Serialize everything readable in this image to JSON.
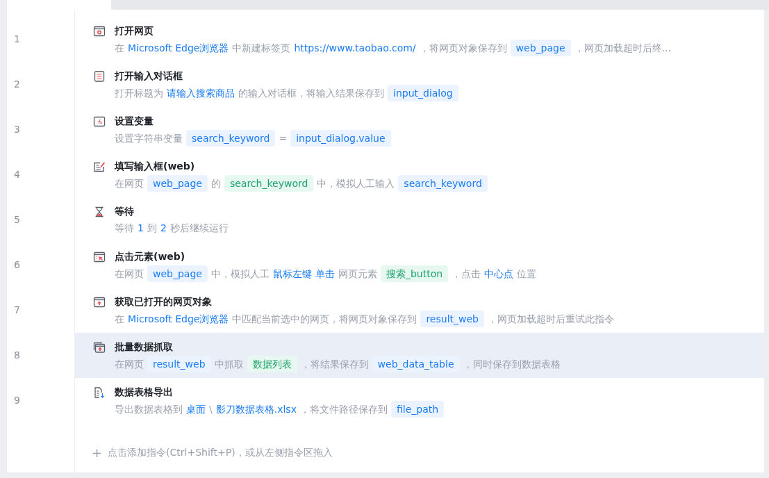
{
  "steps": [
    {
      "number": "1",
      "kind": "browser",
      "title": "打开网页",
      "selected": false,
      "description": [
        {
          "kind": "text",
          "text": "在"
        },
        {
          "kind": "value",
          "text": "Microsoft Edge浏览器"
        },
        {
          "kind": "text",
          "text": "中新建标签页"
        },
        {
          "kind": "value",
          "text": "https://www.taobao.com/"
        },
        {
          "kind": "text",
          "text": "，将网页对象保存到"
        },
        {
          "kind": "variable",
          "text": "web_page"
        },
        {
          "kind": "text",
          "text": "，网页加载超时后终..."
        }
      ]
    },
    {
      "number": "2",
      "kind": "dialog",
      "title": "打开输入对话框",
      "selected": false,
      "description": [
        {
          "kind": "text",
          "text": "打开标题为"
        },
        {
          "kind": "value",
          "text": "请输入搜索商品"
        },
        {
          "kind": "text",
          "text": "的输入对话框，将输入结果保存到"
        },
        {
          "kind": "variable",
          "text": "input_dialog"
        }
      ]
    },
    {
      "number": "3",
      "kind": "variable",
      "title": "设置变量",
      "selected": false,
      "description": [
        {
          "kind": "text",
          "text": "设置字符串变量"
        },
        {
          "kind": "variable",
          "text": "search_keyword"
        },
        {
          "kind": "text",
          "text": "="
        },
        {
          "kind": "variable",
          "text": "input_dialog.value"
        }
      ]
    },
    {
      "number": "4",
      "kind": "input",
      "title": "填写输入框(web)",
      "selected": false,
      "description": [
        {
          "kind": "text",
          "text": "在网页"
        },
        {
          "kind": "variable",
          "text": "web_page"
        },
        {
          "kind": "text",
          "text": "的"
        },
        {
          "kind": "element",
          "text": "search_keyword"
        },
        {
          "kind": "text",
          "text": "中，模拟人工输入"
        },
        {
          "kind": "variable",
          "text": "search_keyword"
        }
      ]
    },
    {
      "number": "5",
      "kind": "wait",
      "title": "等待",
      "selected": false,
      "description": [
        {
          "kind": "text",
          "text": "等待"
        },
        {
          "kind": "value",
          "text": "1"
        },
        {
          "kind": "text",
          "text": "到"
        },
        {
          "kind": "value",
          "text": "2"
        },
        {
          "kind": "text",
          "text": "秒后继续运行"
        }
      ]
    },
    {
      "number": "6",
      "kind": "click",
      "title": "点击元素(web)",
      "selected": false,
      "description": [
        {
          "kind": "text",
          "text": "在网页"
        },
        {
          "kind": "variable",
          "text": "web_page"
        },
        {
          "kind": "text",
          "text": "中，模拟人工"
        },
        {
          "kind": "value",
          "text": "鼠标左键"
        },
        {
          "kind": "value",
          "text": "单击"
        },
        {
          "kind": "text",
          "text": "网页元素"
        },
        {
          "kind": "element",
          "text": "搜索_button"
        },
        {
          "kind": "text",
          "text": "，点击"
        },
        {
          "kind": "value",
          "text": "中心点"
        },
        {
          "kind": "text",
          "text": "位置"
        }
      ]
    },
    {
      "number": "7",
      "kind": "fetch",
      "title": "获取已打开的网页对象",
      "selected": false,
      "description": [
        {
          "kind": "text",
          "text": "在"
        },
        {
          "kind": "value",
          "text": "Microsoft Edge浏览器"
        },
        {
          "kind": "text",
          "text": "中匹配当前选中的网页，将网页对象保存到"
        },
        {
          "kind": "variable",
          "text": "result_web"
        },
        {
          "kind": "text",
          "text": "，网页加载超时后重试此指令"
        }
      ]
    },
    {
      "number": "8",
      "kind": "scrape",
      "title": "批量数据抓取",
      "selected": true,
      "description": [
        {
          "kind": "text",
          "text": "在网页"
        },
        {
          "kind": "variable",
          "text": "result_web"
        },
        {
          "kind": "text",
          "text": "中抓取"
        },
        {
          "kind": "element",
          "text": "数据列表"
        },
        {
          "kind": "text",
          "text": "，将结果保存到"
        },
        {
          "kind": "variable",
          "text": "web_data_table"
        },
        {
          "kind": "text",
          "text": "，同时保存到数据表格"
        }
      ]
    },
    {
      "number": "9",
      "kind": "export",
      "title": "数据表格导出",
      "selected": false,
      "description": [
        {
          "kind": "text",
          "text": "导出数据表格到"
        },
        {
          "kind": "value",
          "text": "桌面"
        },
        {
          "kind": "text",
          "text": "\\"
        },
        {
          "kind": "value",
          "text": "影刀数据表格.xlsx"
        },
        {
          "kind": "text",
          "text": "，将文件路径保存到"
        },
        {
          "kind": "variable",
          "text": "file_path"
        }
      ]
    }
  ],
  "add_hint": {
    "icon": "+",
    "text": "点击添加指令(Ctrl+Shift+P)，或从左侧指令区拖入"
  }
}
